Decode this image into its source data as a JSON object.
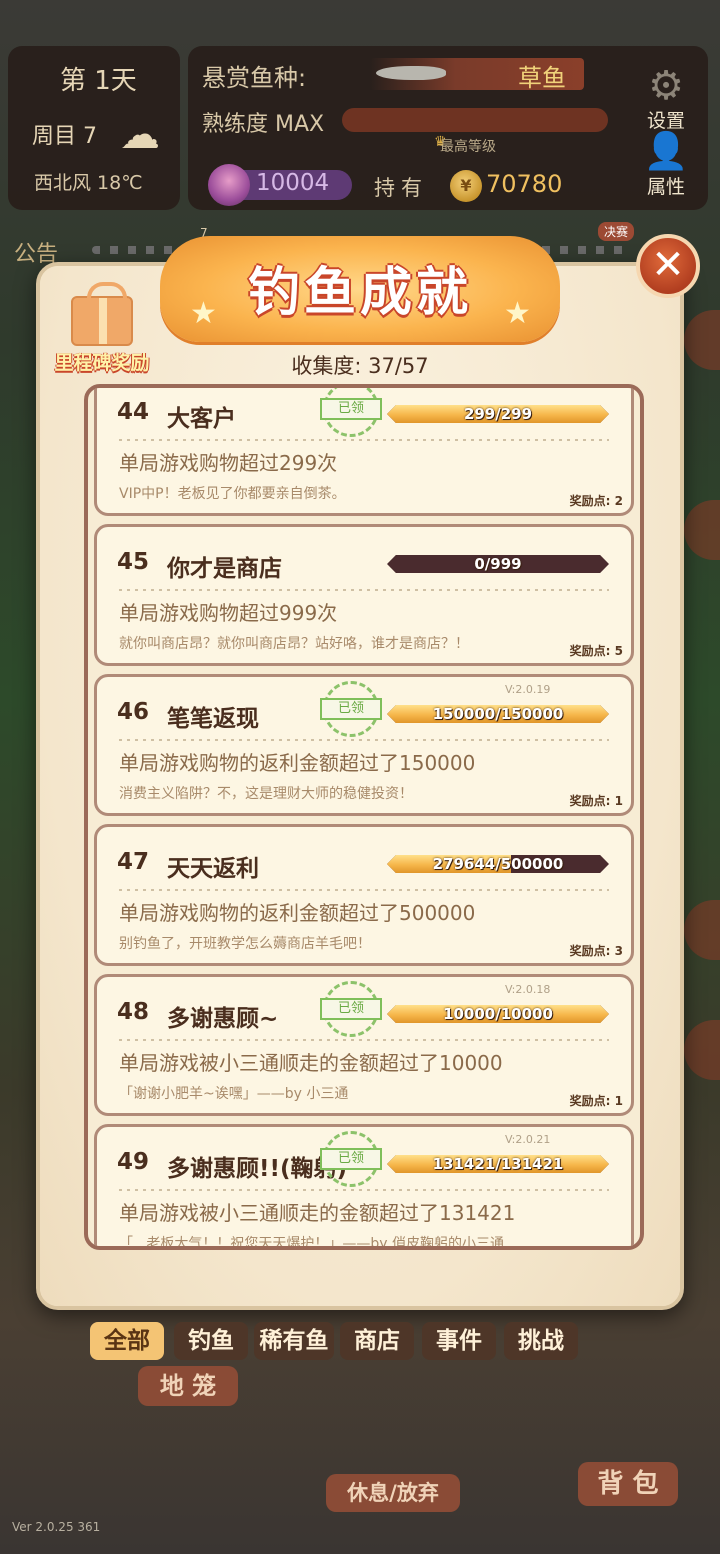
{
  "hud": {
    "day": "第 1天",
    "week": "周目 7",
    "weather_icon": "rain-cloud-icon",
    "wind": "西北风 18℃",
    "bounty_label": "悬赏鱼种:",
    "bounty_fish": "草鱼",
    "mastery_label": "熟练度 MAX",
    "mastery_level": 1.0,
    "max_level_label": "最高等级",
    "gems": "10004",
    "hold_label": "持有",
    "coin_symbol": "¥",
    "coins": "70780",
    "settings_label": "设置",
    "profile_label": "属性"
  },
  "notice": {
    "label": "公告",
    "stage_num": "7",
    "final_badge": "决赛"
  },
  "modal": {
    "title": "钓鱼成就",
    "close_symbol": "✕",
    "milestone_label": "里程碑奖励",
    "collection": "收集度: 37/57",
    "claimed_label": "已领",
    "achievements": [
      {
        "num": "44",
        "name": "大客户",
        "progress": "299/299",
        "fraction": 1.0,
        "claimed": true,
        "desc": "单局游戏购物超过299次",
        "flavor": "VIP中P！老板见了你都要亲自倒茶。",
        "points": "奖励点: 2",
        "version": ""
      },
      {
        "num": "45",
        "name": "你才是商店",
        "progress": "0/999",
        "fraction": 0.0,
        "claimed": false,
        "desc": "单局游戏购物超过999次",
        "flavor": "就你叫商店昂？就你叫商店昂？站好咯，谁才是商店？！",
        "points": "奖励点: 5",
        "version": ""
      },
      {
        "num": "46",
        "name": "笔笔返现",
        "progress": "150000/150000",
        "fraction": 1.0,
        "claimed": true,
        "desc": "单局游戏购物的返利金额超过了150000",
        "flavor": "消费主义陷阱？不，这是理财大师的稳健投资！",
        "points": "奖励点: 1",
        "version": "V:2.0.19"
      },
      {
        "num": "47",
        "name": "天天返利",
        "progress": "279644/500000",
        "fraction": 0.559,
        "claimed": false,
        "desc": "单局游戏购物的返利金额超过了500000",
        "flavor": "别钓鱼了，开班教学怎么薅商店羊毛吧！",
        "points": "奖励点: 3",
        "version": ""
      },
      {
        "num": "48",
        "name": "多谢惠顾~",
        "progress": "10000/10000",
        "fraction": 1.0,
        "claimed": true,
        "desc": "单局游戏被小三通顺走的金额超过了10000",
        "flavor": "「谢谢小肥羊~诶嘿」——by 小三通",
        "points": "奖励点: 1",
        "version": "V:2.0.18"
      },
      {
        "num": "49",
        "name": "多谢惠顾!!(鞠躬)",
        "progress": "131421/131421",
        "fraction": 1.0,
        "claimed": true,
        "desc": "单局游戏被小三通顺走的金额超过了131421",
        "flavor": "「...老板大气！！祝您天天爆护！」——by 俏皮鞠躬的小三通",
        "points": "",
        "version": "V:2.0.21"
      }
    ]
  },
  "tabs": [
    {
      "label": "全部",
      "active": true
    },
    {
      "label": "钓鱼",
      "active": false
    },
    {
      "label": "稀有鱼",
      "active": false
    },
    {
      "label": "商店",
      "active": false
    },
    {
      "label": "事件",
      "active": false
    },
    {
      "label": "挑战",
      "active": false
    }
  ],
  "bottom": {
    "cage_label": "地 笼",
    "rest_label": "休息/放弃",
    "bag_label": "背 包",
    "version": "Ver 2.0.25 361"
  }
}
